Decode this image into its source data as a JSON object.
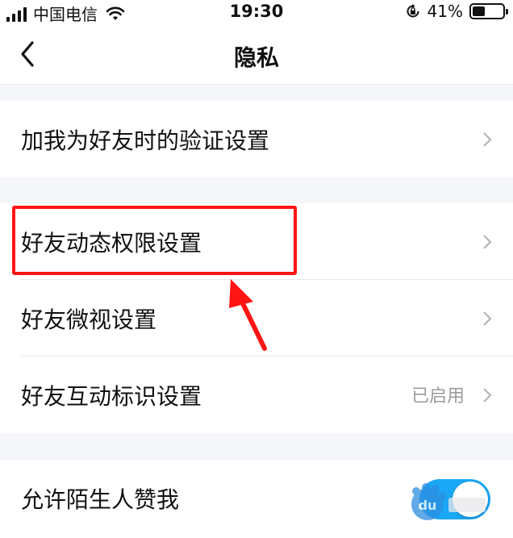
{
  "status_bar": {
    "carrier": "中国电信",
    "time": "19:30",
    "battery_text": "41%",
    "battery_level": 0.41
  },
  "nav": {
    "title": "隐私"
  },
  "groups": [
    {
      "items": [
        {
          "label": "加我为好友时的验证设置"
        }
      ]
    },
    {
      "items": [
        {
          "label": "好友动态权限设置",
          "highlighted": true
        },
        {
          "label": "好友微视设置"
        },
        {
          "label": "好友互动标识设置",
          "value": "已启用"
        }
      ]
    },
    {
      "items": [
        {
          "label": "允许陌生人赞我",
          "toggle_on": true
        }
      ]
    }
  ],
  "colors": {
    "accent": "#1aa7f5",
    "highlight": "#ff1414",
    "background": "#f5f6fa"
  },
  "watermark": {
    "text": "Baidu经验"
  }
}
